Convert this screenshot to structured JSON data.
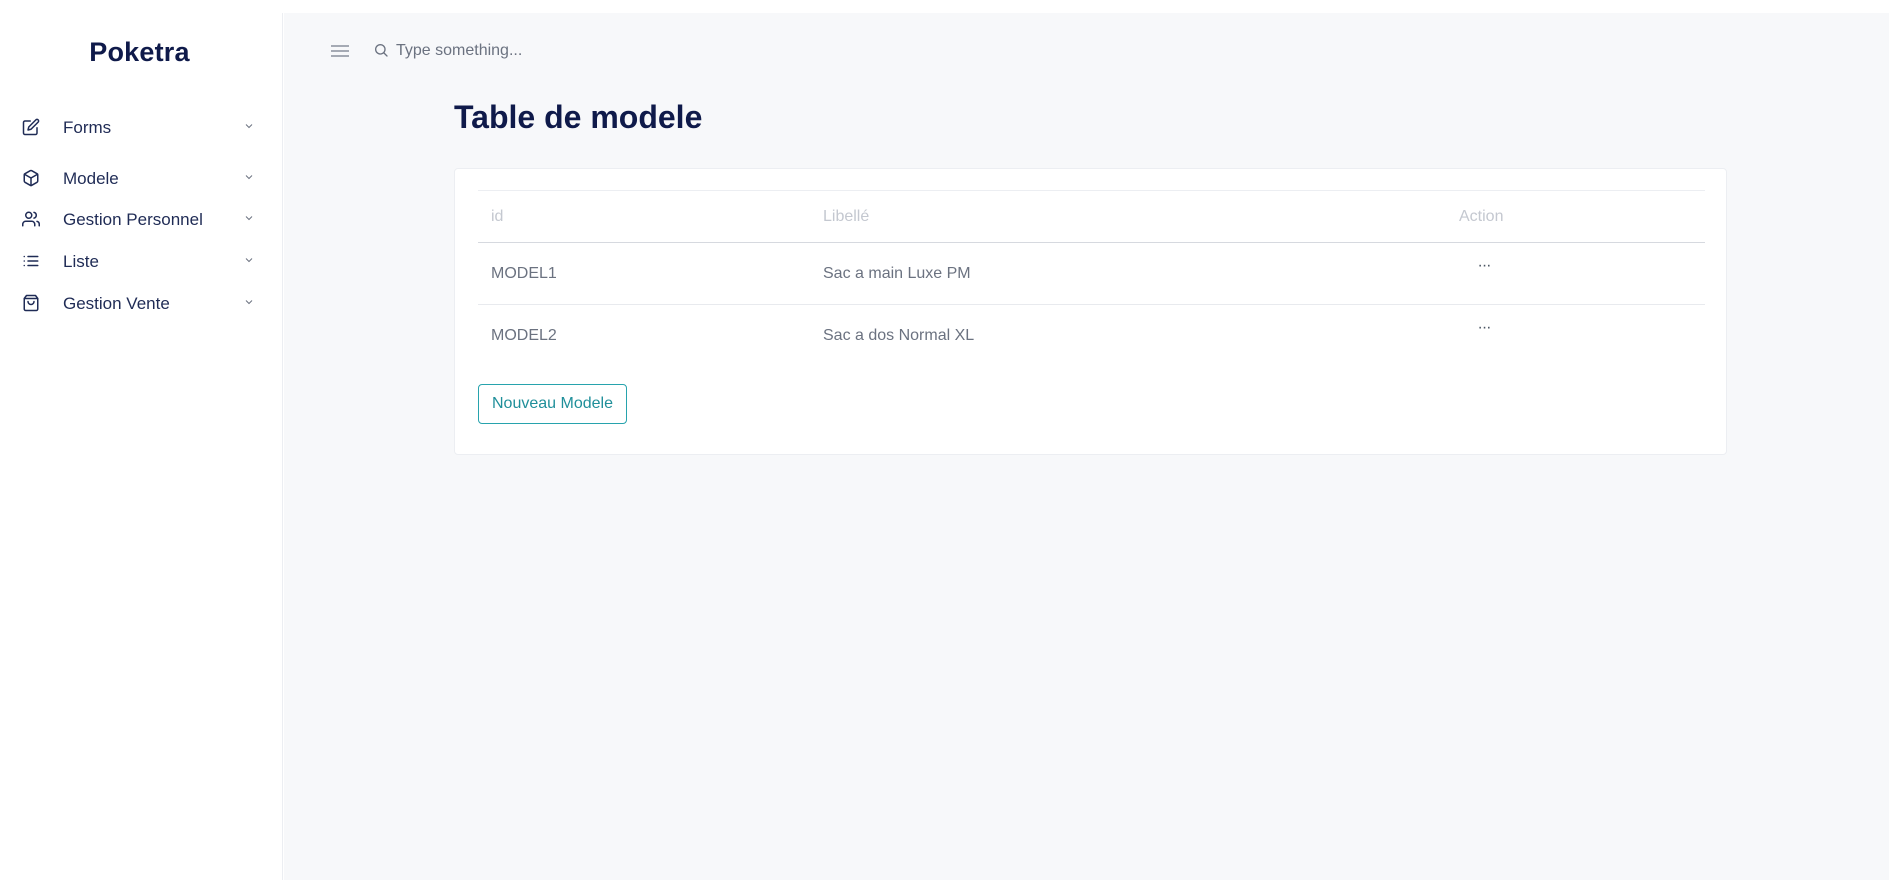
{
  "brand": {
    "name": "Poketra"
  },
  "sidebar": {
    "items": [
      {
        "label": "Forms",
        "icon": "edit-icon"
      },
      {
        "label": "Modele",
        "icon": "box-icon"
      },
      {
        "label": "Gestion Personnel",
        "icon": "users-icon"
      },
      {
        "label": "Liste",
        "icon": "list-icon"
      },
      {
        "label": "Gestion Vente",
        "icon": "shopping-bag-icon"
      }
    ]
  },
  "header": {
    "search_placeholder": "Type something..."
  },
  "main": {
    "title": "Table de modele",
    "table": {
      "columns": [
        "id",
        "Libellé",
        "Action"
      ],
      "rows": [
        {
          "id": "MODEL1",
          "libelle": "Sac a main Luxe PM",
          "action": "···"
        },
        {
          "id": "MODEL2",
          "libelle": "Sac a dos Normal XL",
          "action": "···"
        }
      ]
    },
    "new_button": "Nouveau Modele"
  },
  "colors": {
    "brand_text": "#0f1a4a",
    "accent": "#27a3ad",
    "main_bg": "#f7f8fa"
  }
}
